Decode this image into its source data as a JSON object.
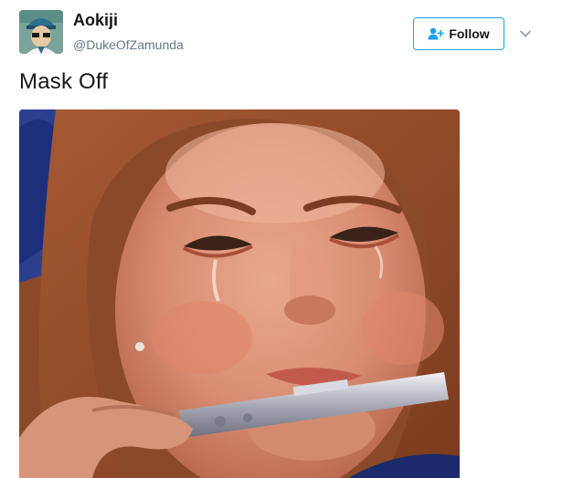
{
  "user": {
    "display_name": "Aokiji",
    "handle": "@DukeOfZamunda",
    "avatar_icon": "avatar-image"
  },
  "actions": {
    "follow_label": "Follow",
    "follow_icon": "add-user-icon",
    "menu_icon": "chevron-down-icon"
  },
  "tweet": {
    "text": "Mask Off"
  },
  "media": {
    "description_icon": "photo"
  },
  "colors": {
    "accent": "#1da1f2",
    "text": "#14171a",
    "muted": "#657786"
  }
}
